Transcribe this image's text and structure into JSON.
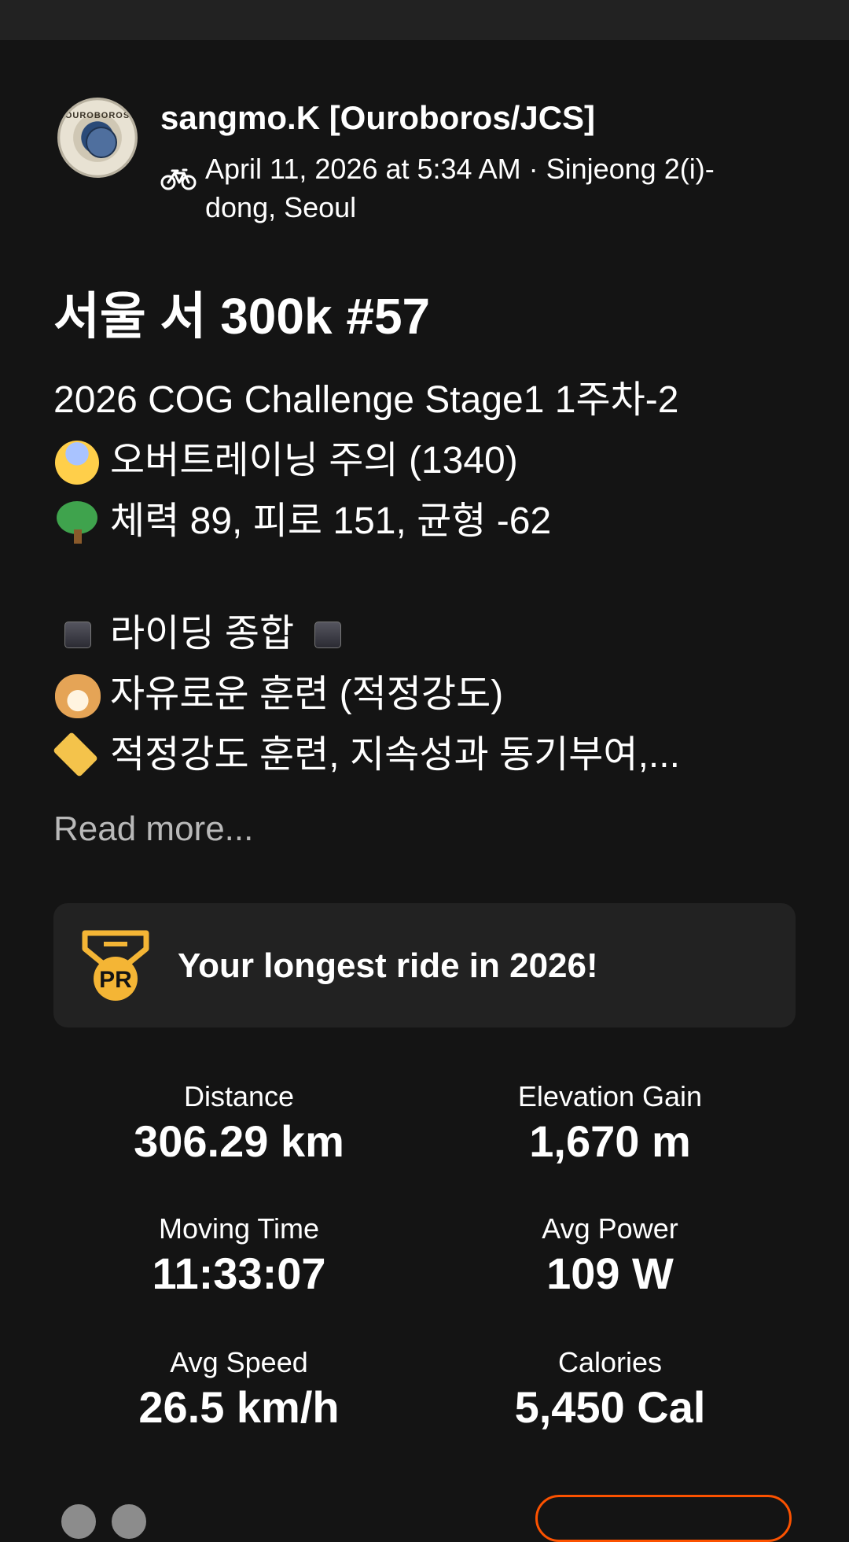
{
  "colors": {
    "background": "#141414",
    "topbar": "#222222",
    "card": "#222222",
    "accent": "#fc5200",
    "pr_gold": "#f4b535",
    "muted": "#b9b9b9"
  },
  "header": {
    "athlete_name": "sangmo.K [Ouroboros/JCS]",
    "avatar_text": "OUROBOROS",
    "activity_icon": "bike-icon",
    "meta": "April 11, 2026 at 5:34 AM · Sinjeong 2(i)-dong, Seoul"
  },
  "activity": {
    "title": "서울 서 300k #57",
    "description_lines": [
      {
        "icon": "",
        "text": "2026 COG Challenge Stage1 1주차-2"
      },
      {
        "icon": "anxious-face-emoji",
        "text": "오버트레이닝 주의 (1340)"
      },
      {
        "icon": "tree-emoji",
        "text": "체력 89, 피로 151, 균형 -62"
      },
      {
        "icon": "square-emoji",
        "text": "라이딩 종합"
      },
      {
        "icon": "dog-face-emoji",
        "text": "자유로운 훈련 (적정강도)"
      },
      {
        "icon": "label-tag-emoji",
        "text": "적정강도 훈련, 지속성과 동기부여,..."
      }
    ],
    "read_more": "Read more..."
  },
  "achievement": {
    "badge_text": "PR",
    "text": "Your longest ride in 2026!"
  },
  "stats": [
    {
      "label": "Distance",
      "value": "306.29 km"
    },
    {
      "label": "Elevation Gain",
      "value": "1,670 m"
    },
    {
      "label": "Moving Time",
      "value": "11:33:07"
    },
    {
      "label": "Avg Power",
      "value": "109 W"
    },
    {
      "label": "Avg Speed",
      "value": "26.5 km/h"
    },
    {
      "label": "Calories",
      "value": "5,450 Cal"
    }
  ]
}
